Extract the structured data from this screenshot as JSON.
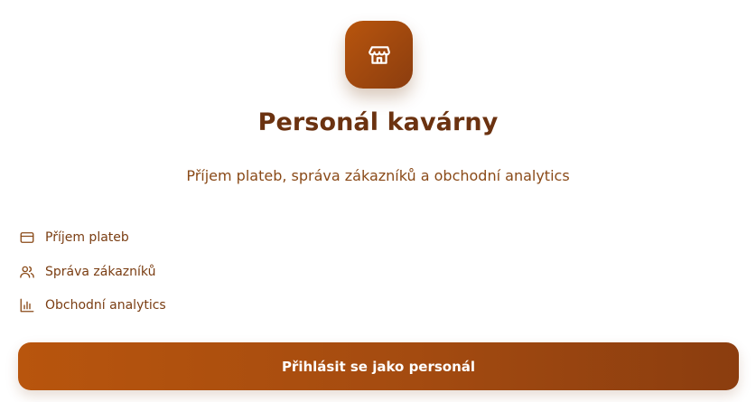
{
  "hero": {
    "icon": "store-icon",
    "title": "Personál kavárny",
    "subtitle": "Příjem plateb, správa zákazníků a obchodní analytics"
  },
  "features": [
    {
      "icon": "credit-card-icon",
      "label": "Příjem plateb"
    },
    {
      "icon": "users-icon",
      "label": "Správa zákazníků"
    },
    {
      "icon": "bar-chart-icon",
      "label": "Obchodní analytics"
    }
  ],
  "login_button": {
    "label": "Přihlásit se jako personál"
  },
  "colors": {
    "accent_start": "#b8550d",
    "accent_end": "#8b3d0f",
    "text": "#7a3d12",
    "title": "#6b3210"
  }
}
